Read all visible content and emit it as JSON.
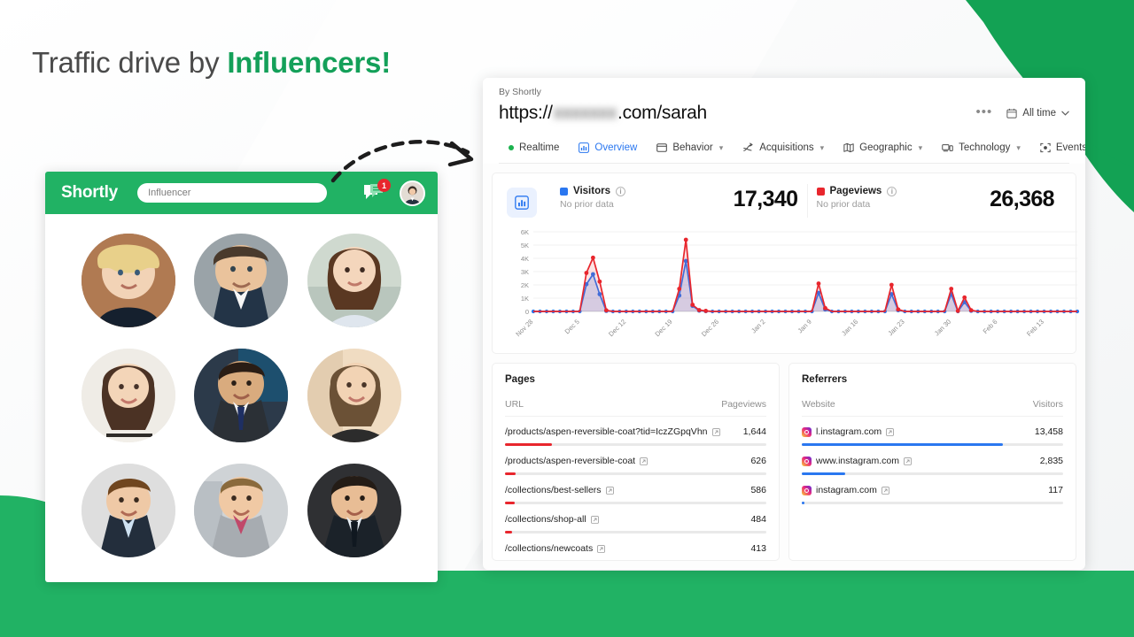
{
  "theme": {
    "green": "#14a059",
    "green_bar": "#21b264",
    "blue": "#2a77f0",
    "red": "#e8262d"
  },
  "headline": {
    "prefix": "Traffic drive by ",
    "accent": "Influencers!"
  },
  "app": {
    "brand": "Shortly",
    "search_placeholder": "Influencer",
    "notification_count": "1",
    "icons": {
      "chat": "chat-icon",
      "avatar": "user-avatar"
    }
  },
  "analytics": {
    "by_line": "By Shortly",
    "url_prefix": "https://",
    "url_blurred": "xxxxxxx",
    "url_suffix": ".com/sarah",
    "more_label": "•••",
    "date_range": "All time",
    "tabs": [
      {
        "label": "Realtime",
        "icon": "live-dot-icon",
        "active": false,
        "caret": false
      },
      {
        "label": "Overview",
        "icon": "bar-chart-icon",
        "active": true,
        "caret": false
      },
      {
        "label": "Behavior",
        "icon": "window-icon",
        "active": false,
        "caret": true
      },
      {
        "label": "Acquisitions",
        "icon": "branch-icon",
        "active": false,
        "caret": true
      },
      {
        "label": "Geographic",
        "icon": "map-icon",
        "active": false,
        "caret": true
      },
      {
        "label": "Technology",
        "icon": "device-icon",
        "active": false,
        "caret": true
      },
      {
        "label": "Events",
        "icon": "target-icon",
        "active": false,
        "caret": false
      }
    ],
    "metrics": [
      {
        "title": "Visitors",
        "sub": "No prior data",
        "value": "17,340",
        "color": "#2a77f0"
      },
      {
        "title": "Pageviews",
        "sub": "No prior data",
        "value": "26,368",
        "color": "#e8262d"
      }
    ],
    "pages": {
      "title": "Pages",
      "col_url": "URL",
      "col_value": "Pageviews",
      "rows": [
        {
          "url": "/products/aspen-reversible-coat?tid=IczZGpqVhn",
          "value": "1,644",
          "pct": 18
        },
        {
          "url": "/products/aspen-reversible-coat",
          "value": "626",
          "pct": 4
        },
        {
          "url": "/collections/best-sellers",
          "value": "586",
          "pct": 3.6
        },
        {
          "url": "/collections/shop-all",
          "value": "484",
          "pct": 2.8
        },
        {
          "url": "/collections/newcoats",
          "value": "413",
          "pct": 2.4
        }
      ]
    },
    "referrers": {
      "title": "Referrers",
      "col_site": "Website",
      "col_value": "Visitors",
      "rows": [
        {
          "site": "l.instagram.com",
          "value": "13,458",
          "pct": 77
        },
        {
          "site": "www.instagram.com",
          "value": "2,835",
          "pct": 16.5
        },
        {
          "site": "instagram.com",
          "value": "117",
          "pct": 0.9
        }
      ]
    }
  },
  "chart_data": {
    "type": "line",
    "title": "",
    "xlabel": "",
    "ylabel": "",
    "ylim": [
      0,
      6000
    ],
    "yticks": [
      "0",
      "1K",
      "2K",
      "3K",
      "4K",
      "5K",
      "6K"
    ],
    "grid": true,
    "legend_position": "top",
    "xtick_labels": [
      "Nov 28",
      "Dec 5",
      "Dec 12",
      "Dec 19",
      "Dec 26",
      "Jan 2",
      "Jan 9",
      "Jan 16",
      "Jan 23",
      "Jan 30",
      "Feb 6",
      "Feb 13"
    ],
    "xtick_indices": [
      0,
      7,
      14,
      21,
      28,
      35,
      42,
      49,
      56,
      63,
      70,
      77
    ],
    "series": [
      {
        "name": "Pageviews",
        "color": "#e8262d",
        "values": [
          0,
          0,
          0,
          0,
          0,
          0,
          0,
          0,
          2900,
          4050,
          2250,
          80,
          0,
          0,
          0,
          0,
          0,
          0,
          0,
          0,
          0,
          0,
          1700,
          5400,
          500,
          100,
          40,
          0,
          0,
          0,
          0,
          0,
          0,
          0,
          0,
          0,
          0,
          0,
          0,
          0,
          0,
          0,
          0,
          2100,
          250,
          0,
          0,
          0,
          0,
          0,
          0,
          0,
          0,
          0,
          2000,
          150,
          0,
          0,
          0,
          0,
          0,
          0,
          0,
          1700,
          40,
          1050,
          90,
          0,
          0,
          0,
          0,
          0,
          0,
          0,
          0,
          0,
          0,
          0,
          0,
          0,
          0,
          0,
          0
        ]
      },
      {
        "name": "Visitors",
        "color": "#2a77f0",
        "values": [
          0,
          0,
          0,
          0,
          0,
          0,
          0,
          0,
          2050,
          2800,
          1300,
          40,
          0,
          0,
          0,
          0,
          0,
          0,
          0,
          0,
          0,
          0,
          1200,
          3800,
          420,
          60,
          20,
          0,
          0,
          0,
          0,
          0,
          0,
          0,
          0,
          0,
          0,
          0,
          0,
          0,
          0,
          0,
          0,
          1400,
          150,
          0,
          0,
          0,
          0,
          0,
          0,
          0,
          0,
          0,
          1300,
          90,
          0,
          0,
          0,
          0,
          0,
          0,
          0,
          1300,
          0,
          700,
          50,
          0,
          0,
          0,
          0,
          0,
          0,
          0,
          0,
          0,
          0,
          0,
          0,
          0,
          0,
          0,
          0
        ]
      }
    ]
  }
}
